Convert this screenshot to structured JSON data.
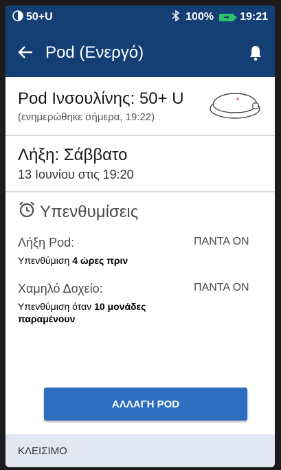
{
  "status_bar": {
    "pod_units": "50+U",
    "battery": "100%",
    "time": "19:21",
    "icons": [
      "pod-status-icon",
      "bluetooth-icon",
      "battery-charging-icon"
    ]
  },
  "app_bar": {
    "title": "Pod (Ενεργό)",
    "icons": [
      "back-arrow-icon",
      "bell-icon"
    ]
  },
  "pod_info": {
    "title": "Pod Ινσουλίνης: 50+ U",
    "updated": "(ενημερώθηκε σήμερα, 19:22)",
    "image": "pod-device-icon"
  },
  "expiry": {
    "title": "Λήξη: Σάββατο",
    "date": "13 Ιουνίου στις 19:20"
  },
  "reminders": {
    "heading": "Υπενθυμίσεις",
    "icon": "alarm-clock-icon",
    "items": [
      {
        "label": "Λήξη Pod:",
        "value": "ΠΑΝΤΑ ΟΝ",
        "desc_prefix": "Υπενθύμιση ",
        "desc_bold": "4 ώρες πριν"
      },
      {
        "label": "Χαμηλό Δοχείο:",
        "value": "ΠΑΝΤΑ ΟΝ",
        "desc_prefix": "Υπενθύμιση όταν ",
        "desc_bold": "10 μονάδες παραμένουν"
      }
    ]
  },
  "primary_button": "ΑΛΛΑΓΗ POD",
  "footer": "ΚΛΕΙΣΙΜΟ",
  "colors": {
    "header": "#143f75",
    "button": "#2d6fbe",
    "footer_bg": "#e3e6f3",
    "battery": "#2fc26a"
  }
}
